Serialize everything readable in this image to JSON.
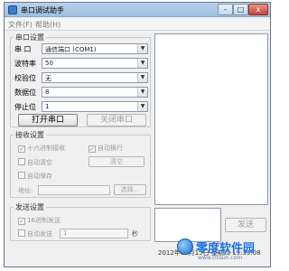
{
  "window": {
    "title": "串口调试助手",
    "minimize_label": "-",
    "maximize_label": "□",
    "close_label": "x"
  },
  "menu": {
    "items": [
      "文件(F)",
      "帮助(H)"
    ]
  },
  "serial_settings": {
    "group_title": "串口设置",
    "port": {
      "label": "串 口",
      "value": "通信端口 (COM1)"
    },
    "baud": {
      "label": "波特率",
      "value": "50"
    },
    "parity": {
      "label": "校验位",
      "value": "无"
    },
    "data_bits": {
      "label": "数据位",
      "value": "8"
    },
    "stop_bits": {
      "label": "停止位",
      "value": "1"
    },
    "open_button": "打开串口",
    "close_button": "关闭串口"
  },
  "receive_settings": {
    "group_title": "接收设置",
    "hex_display": "十六进制接收",
    "auto_newline": "自动换行",
    "auto_clear": "自动清空",
    "clear_button": "清空",
    "auto_save": "自动保存",
    "address_label": "地址:",
    "browse_button": "选择..."
  },
  "send_settings": {
    "group_title": "发送设置",
    "hex_send": "16进制发送",
    "auto_send": "自动发送",
    "interval_value": "1",
    "interval_unit": "秒"
  },
  "send_button": "发送",
  "status": {
    "datetime": "2012年03月15日 星期四 19:33:08"
  },
  "watermark": {
    "brand": "零度软件园",
    "url": "www.05sun.com"
  },
  "colors": {
    "titlebar": "#b9d1ea",
    "window_bg": "#f0f0f0",
    "watermark": "#1b6ee0"
  }
}
